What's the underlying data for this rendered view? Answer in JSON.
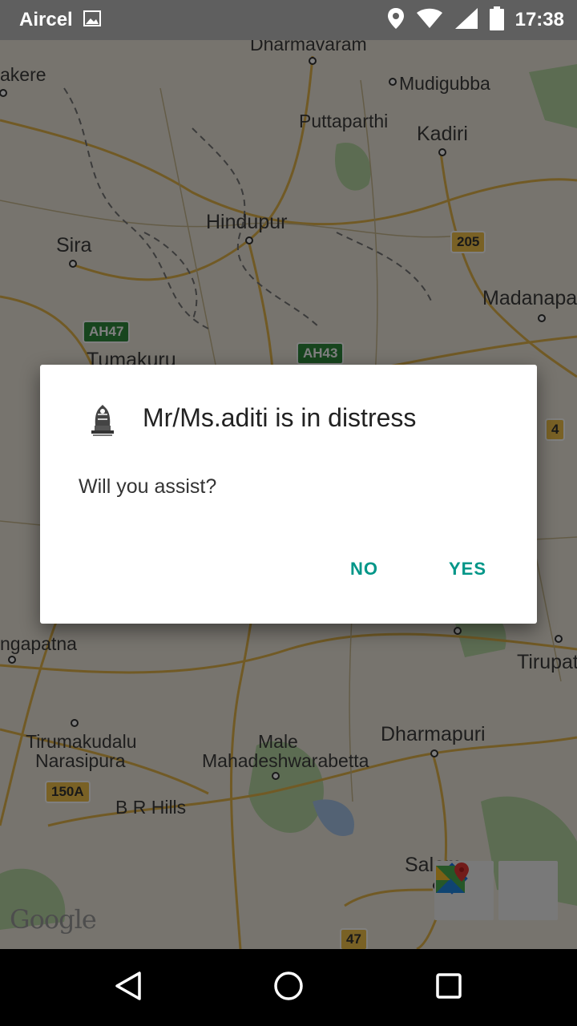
{
  "status_bar": {
    "carrier": "Aircel",
    "time": "17:38",
    "icons": [
      "image-icon",
      "location-icon",
      "wifi-icon",
      "signal-icon",
      "battery-icon"
    ]
  },
  "map": {
    "places": [
      {
        "name": "Dharmavaram"
      },
      {
        "name": "akere"
      },
      {
        "name": "Mudigubba"
      },
      {
        "name": "Puttaparthi"
      },
      {
        "name": "Kadiri"
      },
      {
        "name": "Hindupur"
      },
      {
        "name": "Sira"
      },
      {
        "name": "Madanapa"
      },
      {
        "name": "Tumakuru"
      },
      {
        "name": "ngapatna"
      },
      {
        "name": "Tirupat"
      },
      {
        "name": "Tirumakudalu"
      },
      {
        "name": "Narasipura"
      },
      {
        "name": "Male"
      },
      {
        "name": "Mahadeshwarabetta"
      },
      {
        "name": "Dharmapuri"
      },
      {
        "name": "B R Hills"
      },
      {
        "name": "Salem"
      }
    ],
    "shields": [
      "205",
      "AH47",
      "AH43",
      "4",
      "150A",
      "47"
    ],
    "logo": "Google",
    "fab_icons": [
      "directions-icon",
      "maps-app-icon"
    ]
  },
  "dialog": {
    "title": "Mr/Ms.aditi is in distress",
    "message": "Will you assist?",
    "no_label": "NO",
    "yes_label": "YES",
    "accent": "#009688"
  },
  "nav_bar": {
    "icons": [
      "back-icon",
      "home-icon",
      "recents-icon"
    ]
  }
}
